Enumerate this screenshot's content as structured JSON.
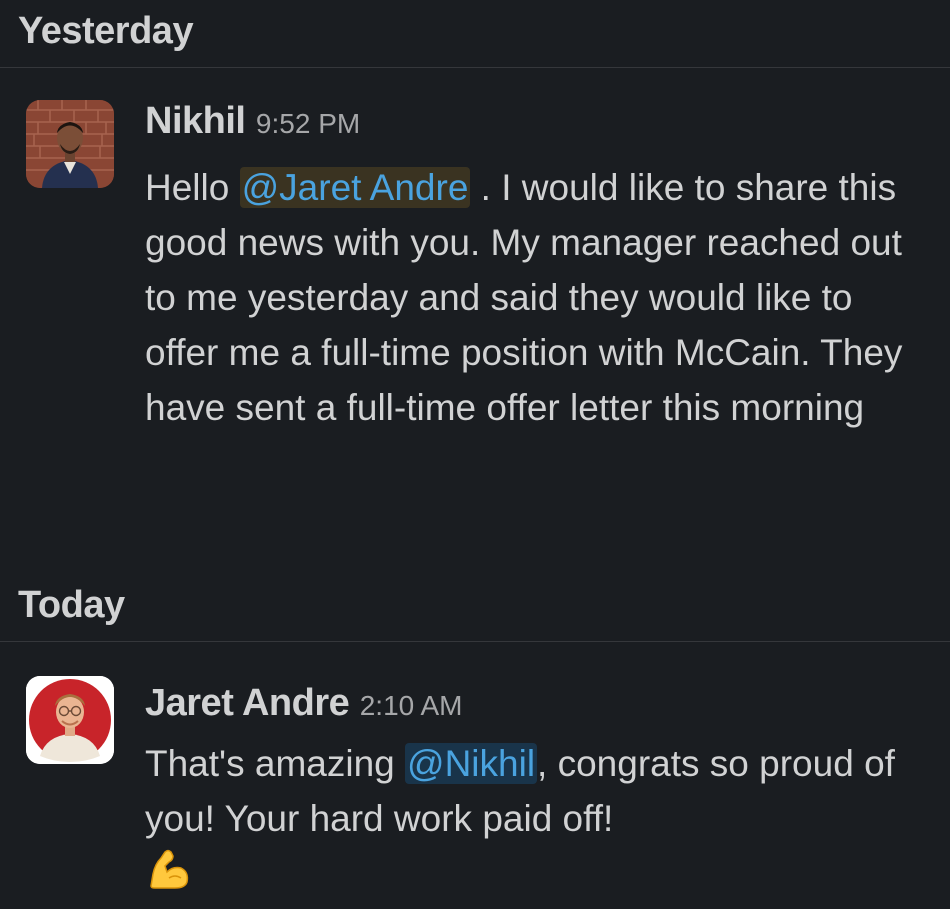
{
  "days": [
    {
      "label": "Yesterday"
    },
    {
      "label": "Today"
    }
  ],
  "messages": [
    {
      "author": "Nikhil",
      "time": "9:52 PM",
      "text_pre": "Hello ",
      "mention": "@Jaret Andre",
      "text_post": " . I would like to share this good news with you. My manager reached out to me yesterday and said they would like to offer me a full-time position with McCain. They have sent a full-time offer letter this morning"
    },
    {
      "author": "Jaret Andre",
      "time": "2:10 AM",
      "text_pre": "That's amazing ",
      "mention": "@Nikhil",
      "text_post": ", congrats so proud of you! Your hard work paid off!",
      "emoji": "flexed-biceps-icon"
    }
  ],
  "colors": {
    "background": "#1a1d21",
    "text": "#d1d2d3",
    "mention": "#4aa3df",
    "mention_highlight_amber": "#3a3321",
    "mention_highlight_blue": "#19344a"
  }
}
